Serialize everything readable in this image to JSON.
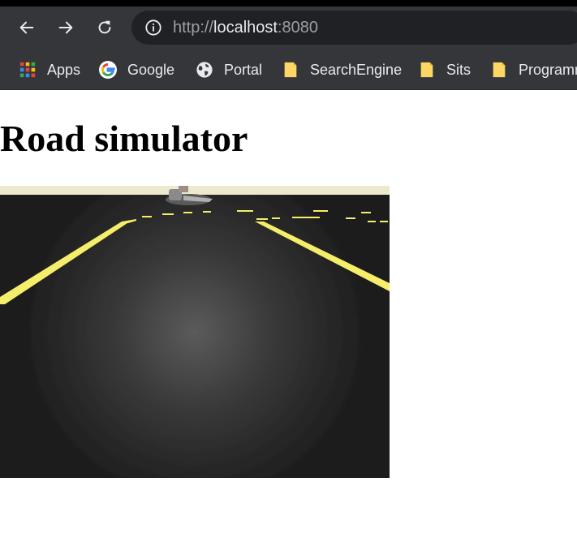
{
  "browser": {
    "url_scheme": "http://",
    "url_host": "localhost",
    "url_port": ":8080",
    "bookmarks": [
      {
        "label": "Apps",
        "icon": "apps-grid-icon"
      },
      {
        "label": "Google",
        "icon": "google-icon"
      },
      {
        "label": "Portal",
        "icon": "globe-icon"
      },
      {
        "label": "SearchEngine",
        "icon": "folder-icon"
      },
      {
        "label": "Sits",
        "icon": "folder-icon"
      },
      {
        "label": "Programr",
        "icon": "folder-icon"
      }
    ]
  },
  "page": {
    "title": "Road simulator"
  },
  "colors": {
    "chrome_bg": "#35363a",
    "omnibox_bg": "#202124",
    "lane_marking": "#f5ee6a",
    "asphalt": "#2a2a2a"
  }
}
